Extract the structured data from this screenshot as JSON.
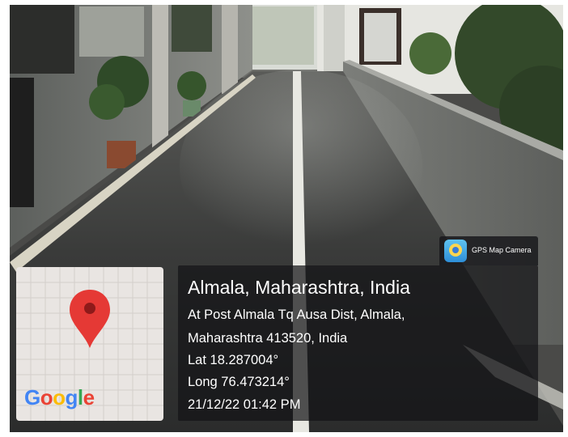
{
  "overlay": {
    "app_name": "GPS Map Camera",
    "map_logo": "Google",
    "place_title": "Almala, Maharashtra, India",
    "address_line1": "At Post Almala Tq Ausa Dist, Almala,",
    "address_line2": "Maharashtra 413520, India",
    "latitude": "Lat 18.287004°",
    "longitude": "Long 76.473214°",
    "datetime": "21/12/22 01:42 PM",
    "icons": {
      "map_pin": "map-pin-icon",
      "app": "gps-map-camera-icon"
    },
    "colors": {
      "pin": "#e53935",
      "panel": "#141416"
    }
  }
}
